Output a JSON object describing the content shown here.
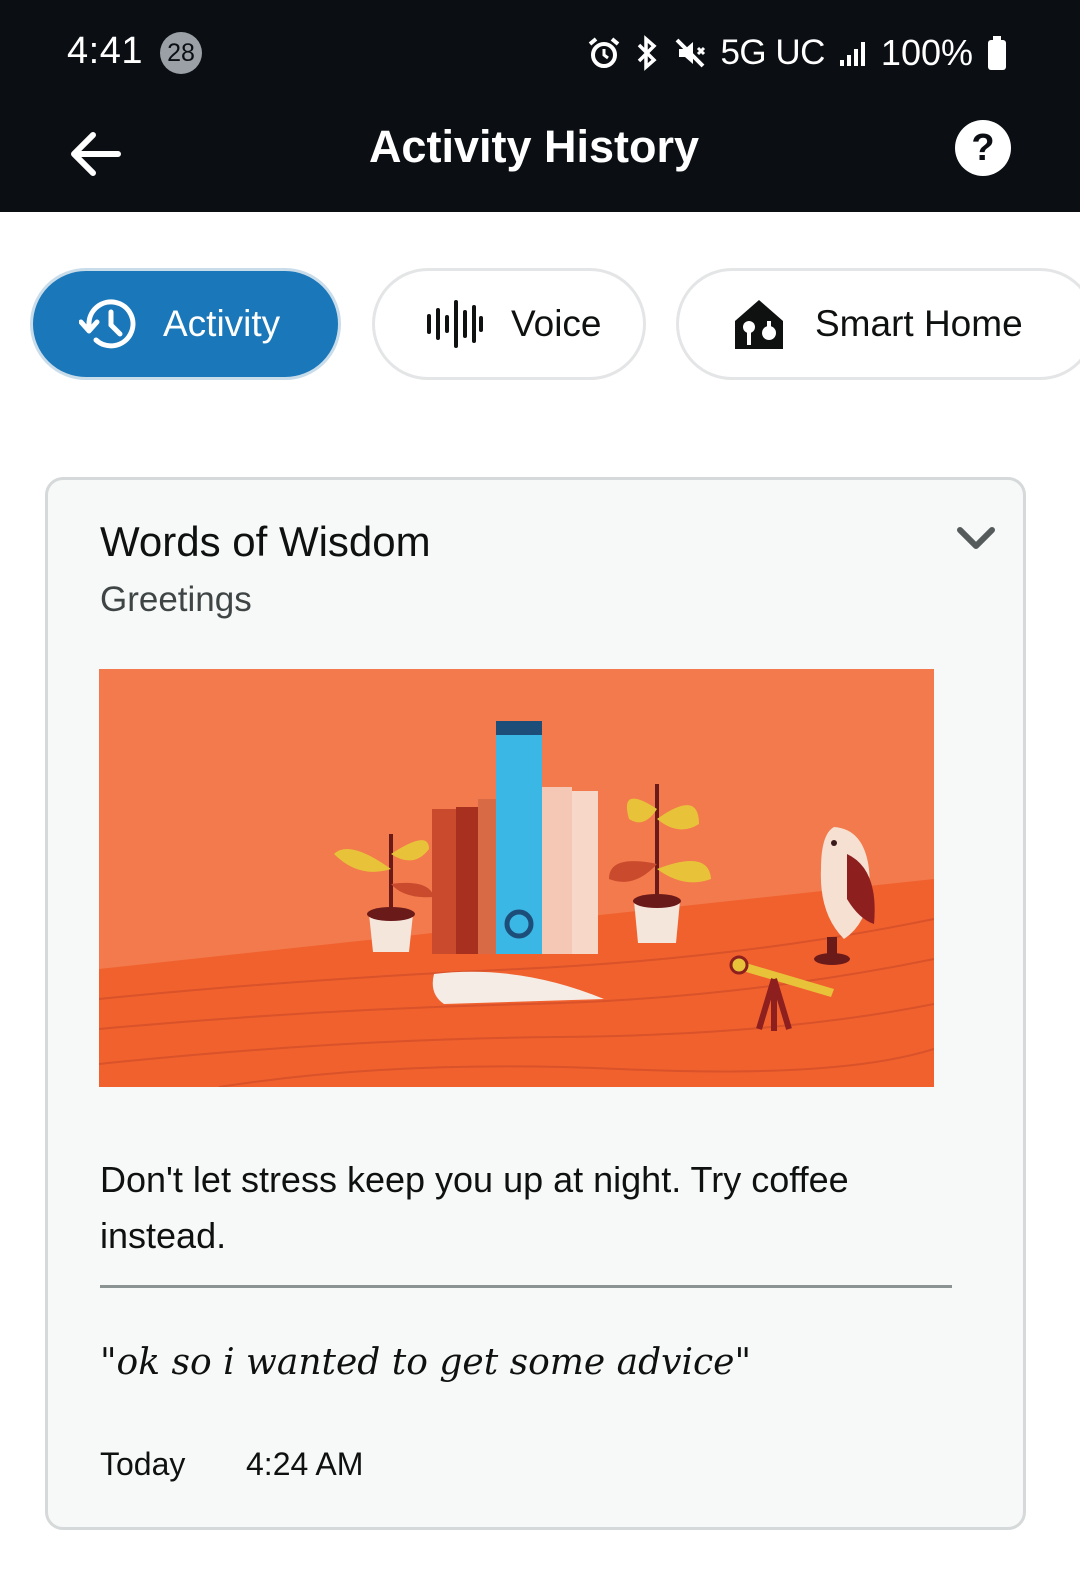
{
  "status_bar": {
    "time": "4:41",
    "notification_count": "28",
    "network": "5G UC",
    "battery": "100%",
    "icons": [
      "alarm-icon",
      "bluetooth-icon",
      "mute-icon",
      "signal-icon",
      "battery-icon"
    ]
  },
  "app_bar": {
    "title": "Activity History",
    "back_icon": "arrow-left-icon",
    "help_label": "?"
  },
  "tabs": [
    {
      "label": "Activity",
      "icon": "history-icon",
      "active": true
    },
    {
      "label": "Voice",
      "icon": "waveform-icon",
      "active": false
    },
    {
      "label": "Smart Home",
      "icon": "home-device-icon",
      "active": false
    }
  ],
  "card": {
    "title": "Words of Wisdom",
    "subtitle": "Greetings",
    "image": "books-plants-owl-telescope-illustration",
    "response": "Don't let stress keep you up at night. Try coffee instead.",
    "utterance": "\"ok so i wanted to get some advice\"",
    "date": "Today",
    "time": "4:24 AM"
  },
  "colors": {
    "status_bar_bg": "#0b0f14",
    "active_tab": "#1a77b9",
    "illustration_bg": "#f27a4c"
  }
}
